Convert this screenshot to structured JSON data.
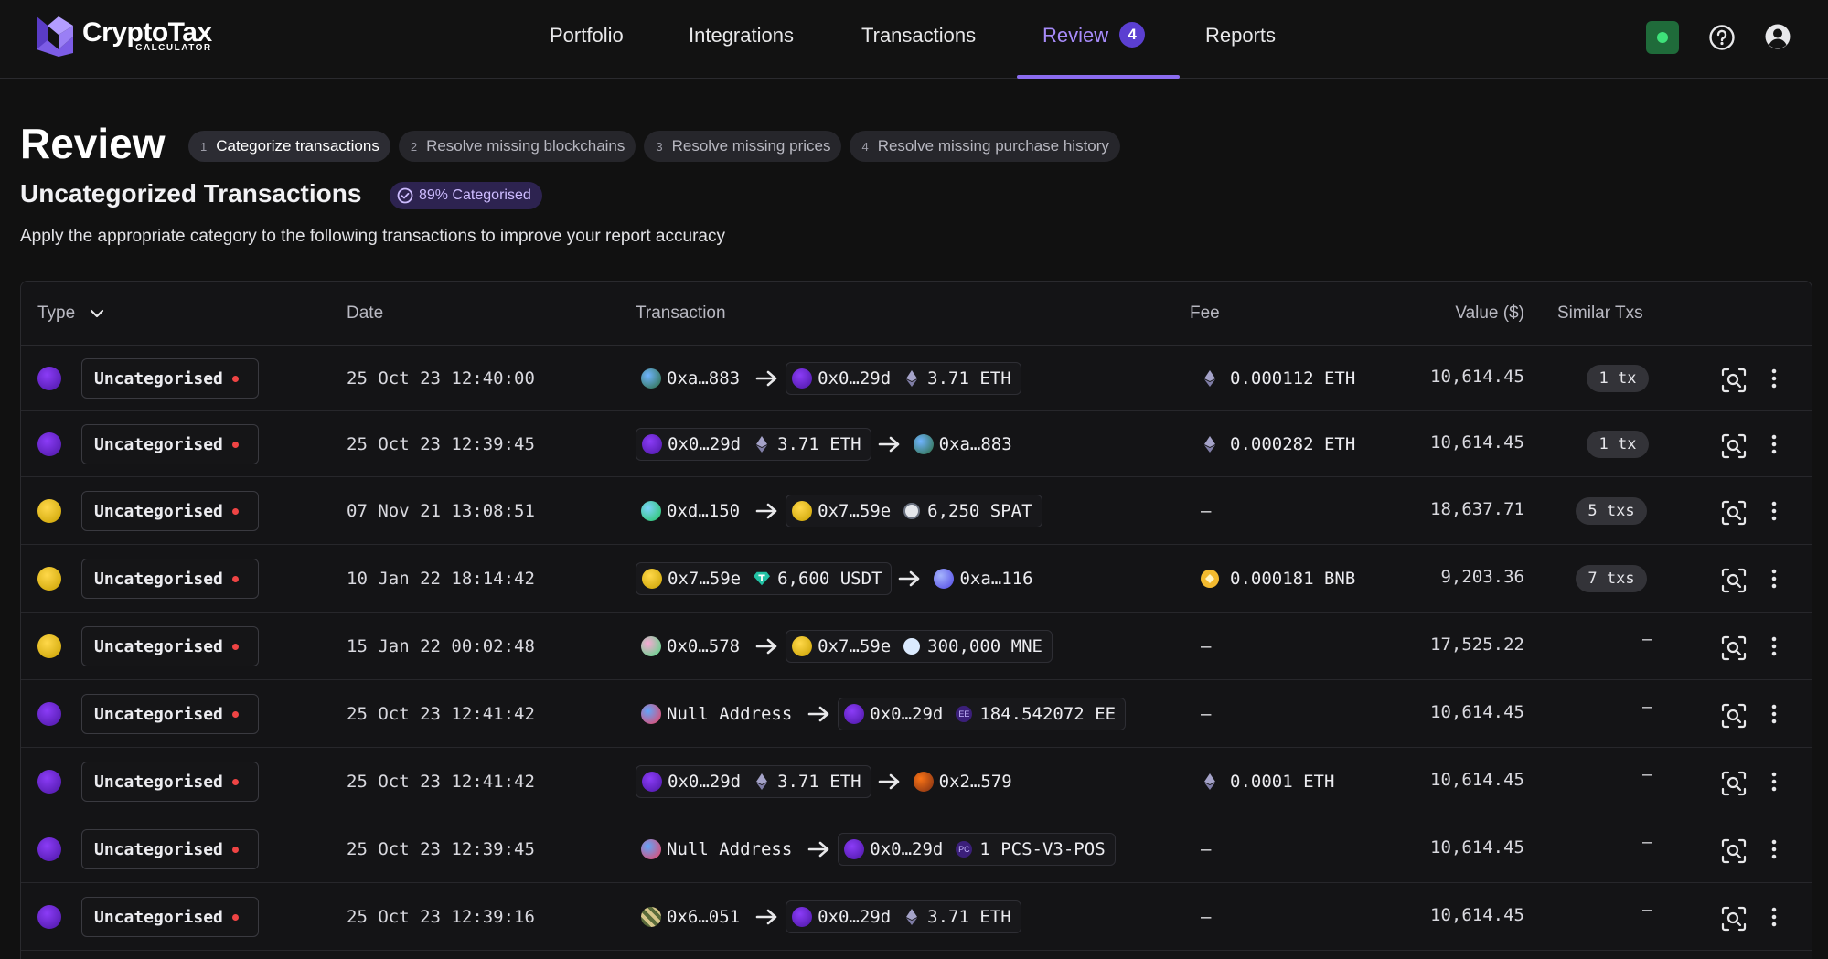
{
  "app": {
    "logo_text": "CryptoTax",
    "logo_sub": "CALCULATOR",
    "nav": [
      {
        "label": "Portfolio"
      },
      {
        "label": "Integrations"
      },
      {
        "label": "Transactions"
      },
      {
        "label": "Review",
        "badge": "4"
      },
      {
        "label": "Reports"
      }
    ],
    "accent": "#8b6cf0"
  },
  "header": {
    "title": "Review",
    "steps": [
      {
        "num": "1",
        "label": "Categorize transactions"
      },
      {
        "num": "2",
        "label": "Resolve missing blockchains"
      },
      {
        "num": "3",
        "label": "Resolve missing prices"
      },
      {
        "num": "4",
        "label": "Resolve missing purchase history"
      }
    ],
    "subtitle": "Uncategorized Transactions",
    "badge": "89% Categorised",
    "description": "Apply the appropriate category to the following transactions to improve your report accuracy"
  },
  "table": {
    "columns": {
      "type": "Type",
      "date": "Date",
      "transaction": "Transaction",
      "fee": "Fee",
      "value": "Value ($)",
      "similar": "Similar Txs"
    },
    "rows": [
      {
        "type": "Uncategorised",
        "avatar": "purple",
        "date": "25 Oct 23 12:40:00",
        "parts": [
          {
            "kind": "chip",
            "icon": "globe",
            "text": "0xa…883"
          },
          {
            "kind": "arrow"
          },
          {
            "kind": "chip",
            "boxed": true,
            "icon": "purple",
            "text": "0x0…29d",
            "token_icon": "eth",
            "amount": "3.71 ETH"
          }
        ],
        "fee_icon": "eth",
        "fee": "0.000112 ETH",
        "value": "10,614.45",
        "similar": "1 tx"
      },
      {
        "type": "Uncategorised",
        "avatar": "purple",
        "date": "25 Oct 23 12:39:45",
        "parts": [
          {
            "kind": "chip",
            "boxed": true,
            "icon": "purple",
            "text": "0x0…29d",
            "token_icon": "eth",
            "amount": "3.71 ETH"
          },
          {
            "kind": "arrow"
          },
          {
            "kind": "chip",
            "icon": "globe",
            "text": "0xa…883"
          }
        ],
        "fee_icon": "eth",
        "fee": "0.000282 ETH",
        "value": "10,614.45",
        "similar": "1 tx"
      },
      {
        "type": "Uncategorised",
        "avatar": "yellow",
        "date": "07 Nov 21 13:08:51",
        "parts": [
          {
            "kind": "chip",
            "icon": "globe-green",
            "text": "0xd…150"
          },
          {
            "kind": "arrow"
          },
          {
            "kind": "chip",
            "boxed": true,
            "icon": "yellow",
            "text": "0x7…59e",
            "token_icon": "spat",
            "amount": "6,250 SPAT"
          }
        ],
        "fee_icon": "",
        "fee": "–",
        "value": "18,637.71",
        "similar": "5 txs"
      },
      {
        "type": "Uncategorised",
        "avatar": "yellow",
        "date": "10 Jan 22 18:14:42",
        "parts": [
          {
            "kind": "chip",
            "boxed": true,
            "icon": "yellow",
            "text": "0x7…59e",
            "token_icon": "usdt",
            "amount": "6,600 USDT"
          },
          {
            "kind": "arrow"
          },
          {
            "kind": "chip",
            "icon": "bluepurple",
            "text": "0xa…116"
          }
        ],
        "fee_icon": "bnb",
        "fee": "0.000181 BNB",
        "value": "9,203.36",
        "similar": "7 txs"
      },
      {
        "type": "Uncategorised",
        "avatar": "yellow",
        "date": "15 Jan 22 00:02:48",
        "parts": [
          {
            "kind": "chip",
            "icon": "pinkgreen",
            "text": "0x0…578"
          },
          {
            "kind": "arrow"
          },
          {
            "kind": "chip",
            "boxed": true,
            "icon": "yellow",
            "text": "0x7…59e",
            "token_icon": "mne",
            "amount": "300,000 MNE"
          }
        ],
        "fee_icon": "",
        "fee": "–",
        "value": "17,525.22",
        "similar": "–"
      },
      {
        "type": "Uncategorised",
        "avatar": "purple",
        "date": "25 Oct 23 12:41:42",
        "parts": [
          {
            "kind": "chip",
            "icon": "null",
            "text": "Null Address"
          },
          {
            "kind": "arrow"
          },
          {
            "kind": "chip",
            "boxed": true,
            "icon": "purple",
            "text": "0x0…29d",
            "token_icon": "ee",
            "token_text": "EE",
            "amount": "184.542072 EE"
          }
        ],
        "fee_icon": "",
        "fee": "–",
        "value": "10,614.45",
        "similar": "–"
      },
      {
        "type": "Uncategorised",
        "avatar": "purple",
        "date": "25 Oct 23 12:41:42",
        "parts": [
          {
            "kind": "chip",
            "boxed": true,
            "icon": "purple",
            "text": "0x0…29d",
            "token_icon": "eth",
            "amount": "3.71 ETH"
          },
          {
            "kind": "arrow"
          },
          {
            "kind": "chip",
            "icon": "brown",
            "text": "0x2…579"
          }
        ],
        "fee_icon": "eth",
        "fee": "0.0001 ETH",
        "value": "10,614.45",
        "similar": "–"
      },
      {
        "type": "Uncategorised",
        "avatar": "purple",
        "date": "25 Oct 23 12:39:45",
        "parts": [
          {
            "kind": "chip",
            "icon": "null",
            "text": "Null Address"
          },
          {
            "kind": "arrow"
          },
          {
            "kind": "chip",
            "boxed": true,
            "icon": "purple",
            "text": "0x0…29d",
            "token_icon": "pc",
            "token_text": "PC",
            "amount": "1 PCS-V3-POS"
          }
        ],
        "fee_icon": "",
        "fee": "–",
        "value": "10,614.45",
        "similar": "–"
      },
      {
        "type": "Uncategorised",
        "avatar": "purple",
        "date": "25 Oct 23 12:39:16",
        "parts": [
          {
            "kind": "chip",
            "icon": "pixel",
            "text": "0x6…051"
          },
          {
            "kind": "arrow"
          },
          {
            "kind": "chip",
            "boxed": true,
            "icon": "purple",
            "text": "0x0…29d",
            "token_icon": "eth",
            "amount": "3.71 ETH"
          }
        ],
        "fee_icon": "",
        "fee": "–",
        "value": "10,614.45",
        "similar": "–"
      }
    ]
  }
}
